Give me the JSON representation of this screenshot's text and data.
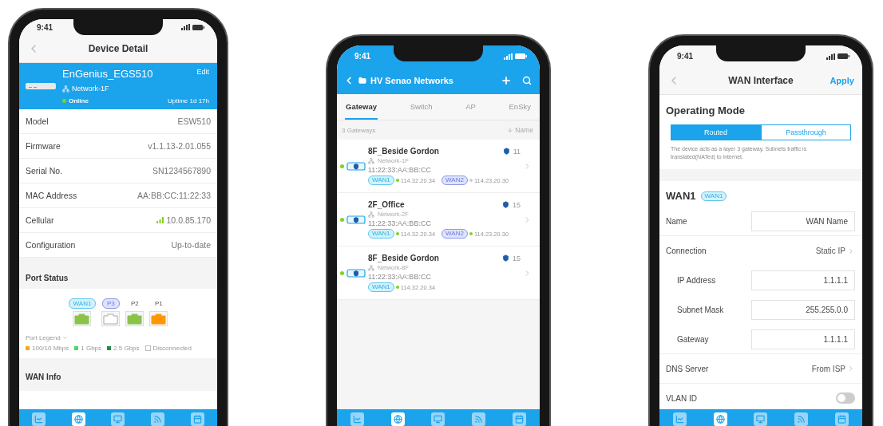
{
  "phones": [
    {
      "kind": "device_detail",
      "time": "9:41",
      "nav": {
        "title": "Device Detail"
      },
      "device": {
        "name": "EnGenius_EGS510",
        "network": "Network-1F",
        "status": "Online",
        "online": true,
        "action": "Edit",
        "uptime": "Uptime 1d 17h"
      },
      "details": [
        {
          "label": "Model",
          "value": "ESW510",
          "kind": "text"
        },
        {
          "label": "Firmware",
          "value": "v1.1.13-2.01.055",
          "kind": "text"
        },
        {
          "label": "Serial No.",
          "value": "SN1234567890",
          "kind": "text"
        },
        {
          "label": "MAC Address",
          "value": "AA:BB:CC:11:22:33",
          "kind": "text"
        },
        {
          "label": "Cellular",
          "value": "10.0.85.170",
          "kind": "signal"
        },
        {
          "label": "Configuration",
          "value": "Up-to-date",
          "kind": "text"
        }
      ],
      "port_status": {
        "title": "Port Status",
        "ports": [
          {
            "label": "WAN1",
            "kind": "wan",
            "color": "#8bc34a"
          },
          {
            "label": "P3",
            "kind": "lan",
            "color": "#ffffff"
          },
          {
            "label": "P2",
            "kind": "plain",
            "color": "#8bc34a"
          },
          {
            "label": "P1",
            "kind": "plain",
            "color": "#ff9800"
          }
        ],
        "legend_title": "Port Legend",
        "legend": [
          {
            "label": "100/10 Mbps",
            "color": "#f5a623"
          },
          {
            "label": "1 Gbps",
            "color": "#4cd964"
          },
          {
            "label": "2.5 Gbps",
            "color": "#1e8e3e"
          },
          {
            "label": "Disconnected",
            "color": "#ffffff"
          }
        ]
      },
      "wan_info": {
        "title": "WAN Info"
      },
      "tab_bar": [
        {
          "selected": false
        },
        {
          "selected": true
        },
        {
          "selected": false
        },
        {
          "selected": false
        },
        {
          "selected": false
        }
      ]
    },
    {
      "kind": "device_list",
      "time": "9:41",
      "header": {
        "title": "HV Senao Networks"
      },
      "tabs": [
        {
          "label": "Gateway",
          "selected": true
        },
        {
          "label": "Switch",
          "selected": false
        },
        {
          "label": "AP",
          "selected": false
        },
        {
          "label": "EnSky",
          "selected": false
        }
      ],
      "summary": "3 Gateways",
      "sort": "Name",
      "devices": [
        {
          "name": "8F_Beside Gordon",
          "online": true,
          "clients": "11",
          "network": "Network-1F",
          "mac": "11:22:33:AA:BB:CC",
          "wans": [
            {
              "label": "WAN1",
              "kind": "wan1",
              "online": true,
              "ip": "114.32.20.34"
            },
            {
              "label": "WAN2",
              "kind": "wan2",
              "online": false,
              "ip": "114.23.20.30"
            }
          ]
        },
        {
          "name": "2F_Office",
          "online": true,
          "clients": "15",
          "network": "Network-2F",
          "mac": "11:22:33:AA:BB:CC",
          "wans": [
            {
              "label": "WAN1",
              "kind": "wan1",
              "online": true,
              "ip": "114.32.20.34"
            },
            {
              "label": "WAN2",
              "kind": "wan2",
              "online": true,
              "ip": "114.23.20.30"
            }
          ]
        },
        {
          "name": "8F_Beside Gordon",
          "online": true,
          "clients": "15",
          "network": "Network-8F",
          "mac": "11:22:33:AA:BB:CC",
          "wans": [
            {
              "label": "WAN1",
              "kind": "wan1",
              "online": true,
              "ip": "114.32.20.34"
            }
          ]
        }
      ],
      "tab_bar": [
        {
          "selected": false
        },
        {
          "selected": true
        },
        {
          "selected": false
        },
        {
          "selected": false
        },
        {
          "selected": false
        }
      ]
    },
    {
      "kind": "wan_settings",
      "time": "9:41",
      "nav": {
        "title": "WAN Interface",
        "action": "Apply"
      },
      "mode": {
        "title": "Operating Mode",
        "options": [
          {
            "label": "Routed",
            "selected": true
          },
          {
            "label": "Passthrough",
            "selected": false
          }
        ],
        "description": "The device acts as a layer 3 gateway. Subnets traffic is translated(NATed) to internet."
      },
      "wan": {
        "title": "WAN1",
        "tag": "WAN1",
        "rows": [
          {
            "kind": "field",
            "label": "Name",
            "value": "WAN Name"
          },
          {
            "kind": "link",
            "label": "Connection",
            "value": "Static IP",
            "children": [
              {
                "kind": "field",
                "label": "IP Address",
                "value": "1.1.1.1"
              },
              {
                "kind": "field",
                "label": "Subnet Mask",
                "value": "255.255.0.0"
              },
              {
                "kind": "field",
                "label": "Gateway",
                "value": "1.1.1.1"
              }
            ]
          },
          {
            "kind": "link",
            "label": "DNS Server",
            "value": "From ISP"
          },
          {
            "kind": "toggle",
            "label": "VLAN ID",
            "on": false
          }
        ]
      },
      "tab_bar": [
        {
          "selected": false
        },
        {
          "selected": true
        },
        {
          "selected": false
        },
        {
          "selected": false
        },
        {
          "selected": false
        }
      ]
    }
  ]
}
